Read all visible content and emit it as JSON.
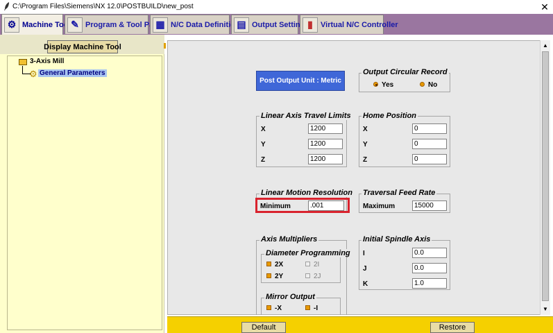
{
  "window": {
    "title": "C:\\Program Files\\Siemens\\NX 12.0\\POSTBUILD\\new_post",
    "close_label": "✕"
  },
  "tabs": [
    {
      "label": "Machine Tool",
      "icon": "machine-tool-icon",
      "active": true
    },
    {
      "label": "Program & Tool Path",
      "icon": "program-icon",
      "active": false
    },
    {
      "label": "N/C Data Definitions",
      "icon": "nc-data-icon",
      "active": false
    },
    {
      "label": "Output Settings",
      "icon": "output-settings-icon",
      "active": false
    },
    {
      "label": "Virtual N/C Controller",
      "icon": "virtual-controller-icon",
      "active": false
    }
  ],
  "left_panel": {
    "display_button": "Display Machine Tool",
    "tree": {
      "root": "3-Axis Mill",
      "child": "General Parameters"
    }
  },
  "main": {
    "post_output_unit": "Post Output Unit : Metric",
    "output_circular_record": {
      "title": "Output Circular Record",
      "options": [
        "Yes",
        "No"
      ],
      "selected": "Yes"
    },
    "linear_axis_travel_limits": {
      "title": "Linear Axis Travel Limits",
      "rows": [
        {
          "label": "X",
          "value": "1200"
        },
        {
          "label": "Y",
          "value": "1200"
        },
        {
          "label": "Z",
          "value": "1200"
        }
      ]
    },
    "home_position": {
      "title": "Home Position",
      "rows": [
        {
          "label": "X",
          "value": "0"
        },
        {
          "label": "Y",
          "value": "0"
        },
        {
          "label": "Z",
          "value": "0"
        }
      ]
    },
    "linear_motion_resolution": {
      "title": "Linear Motion Resolution",
      "label": "Minimum",
      "value": ".001"
    },
    "traversal_feed_rate": {
      "title": "Traversal Feed Rate",
      "label": "Maximum",
      "value": "15000"
    },
    "axis_multipliers": {
      "title": "Axis Multipliers",
      "diameter_programming": {
        "title": "Diameter Programming",
        "items": [
          {
            "label": "2X",
            "checked": true,
            "enabled": true
          },
          {
            "label": "2I",
            "checked": false,
            "enabled": false
          },
          {
            "label": "2Y",
            "checked": true,
            "enabled": true
          },
          {
            "label": "2J",
            "checked": false,
            "enabled": false
          }
        ]
      },
      "mirror_output": {
        "title": "Mirror Output",
        "items": [
          {
            "label": "-X",
            "checked": true,
            "enabled": true
          },
          {
            "label": "-I",
            "checked": true,
            "enabled": true
          }
        ]
      }
    },
    "initial_spindle_axis": {
      "title": "Initial Spindle Axis",
      "rows": [
        {
          "label": "I",
          "value": "0.0"
        },
        {
          "label": "J",
          "value": "0.0"
        },
        {
          "label": "K",
          "value": "1.0"
        }
      ]
    }
  },
  "bottom_bar": {
    "default_label": "Default",
    "restore_label": "Restore"
  },
  "colors": {
    "tab_strip": "#9a76a0",
    "left_panel_bg": "#ffffcc",
    "post_output_button": "#3f67d8",
    "bottom_bar": "#f5d000",
    "highlight": "#d9232e"
  }
}
